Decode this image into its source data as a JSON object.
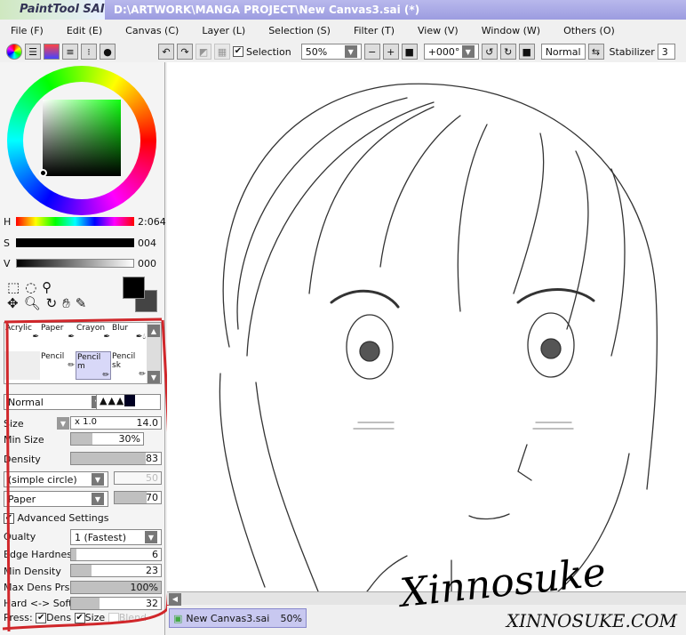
{
  "app": {
    "logo": "PaintTool SAI",
    "title": "D:\\ARTWORK\\MANGA PROJECT\\New Canvas3.sai (*)"
  },
  "menu": [
    "File (F)",
    "Edit (E)",
    "Canvas (C)",
    "Layer (L)",
    "Selection (S)",
    "Filter (T)",
    "View (V)",
    "Window (W)",
    "Others (O)"
  ],
  "toolbar": {
    "selection_label": "Selection",
    "zoom": "50%",
    "rotation": "+000°",
    "blend": "Normal",
    "stabilizer_label": "Stabilizer",
    "stabilizer": "3"
  },
  "color": {
    "h_label": "H",
    "h_value": "2:064",
    "s_label": "S",
    "s_value": "004",
    "v_label": "V",
    "v_value": "000",
    "h_fraction": 0.33,
    "s_fraction": 0.02,
    "v_fraction": 0.0
  },
  "brushes": [
    {
      "name": "Acrylic"
    },
    {
      "name": "Paper"
    },
    {
      "name": "Crayon"
    },
    {
      "name": "Blur"
    },
    {
      "name": ""
    },
    {
      "name": "Pencil"
    },
    {
      "name": "Pencil m",
      "selected": true
    },
    {
      "name": "Pencil sk"
    }
  ],
  "brush_settings": {
    "mode": "Normal",
    "size_label": "Size",
    "size_mult": "x 1.0",
    "size": "14.0",
    "min_size_label": "Min Size",
    "min_size": "30%",
    "min_size_frac": 0.3,
    "density_label": "Density",
    "density": "83",
    "density_frac": 0.83,
    "shape": "(simple circle)",
    "shape_value": "50",
    "texture": "Paper",
    "texture_value": "70",
    "texture_frac": 0.7,
    "advanced_label": "Advanced Settings",
    "quality_label": "Qualty",
    "quality": "1 (Fastest)",
    "edge_label": "Edge Hardness",
    "edge": "6",
    "edge_frac": 0.06,
    "min_density_label": "Min Density",
    "min_density": "23",
    "min_density_frac": 0.23,
    "max_dens_label": "Max Dens Prs.",
    "max_dens": "100%",
    "max_dens_frac": 1.0,
    "hardsoft_label": "Hard <-> Soft",
    "hardsoft": "32",
    "hardsoft_frac": 0.32,
    "press_label": "Press:",
    "dens_label": "Dens",
    "size_press_label": "Size",
    "blend_label": "Blend"
  },
  "tab": {
    "name": "New Canvas3.sai",
    "zoom": "50%"
  },
  "watermark": {
    "signature": "Xinnosuke",
    "url": "XINNOSUKE.COM"
  }
}
